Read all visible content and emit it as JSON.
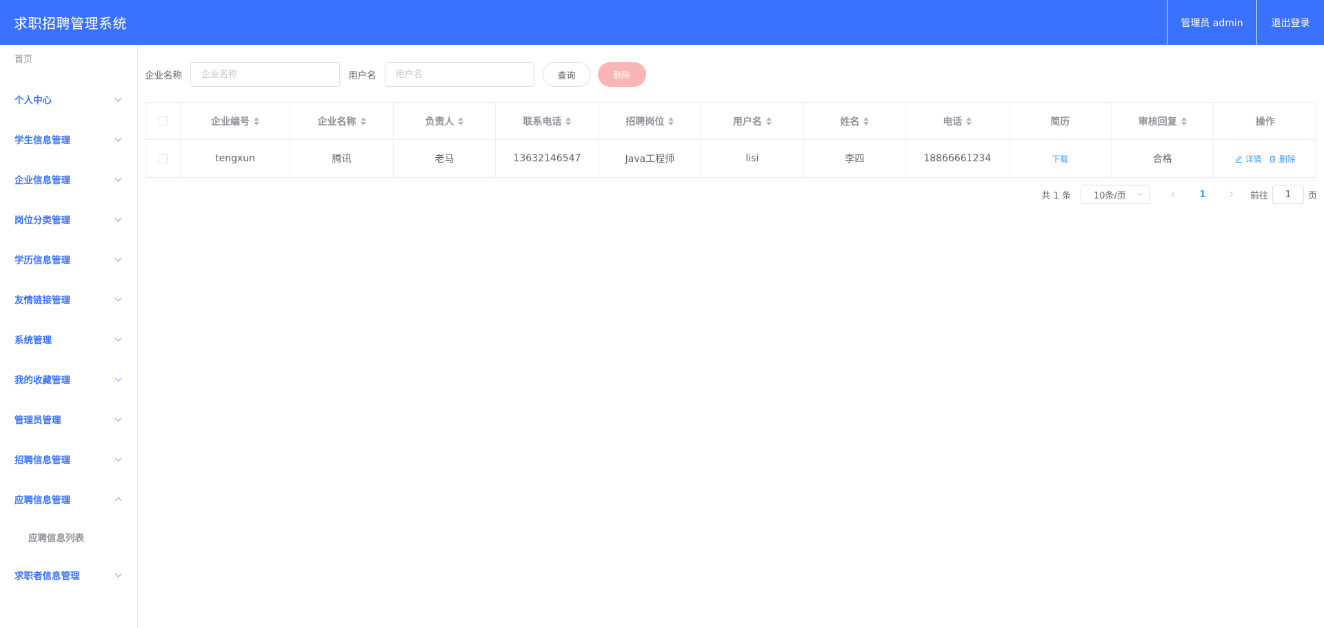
{
  "header": {
    "title": "求职招聘管理系统",
    "admin_label": "管理员 admin",
    "logout_label": "退出登录",
    "color": "#3a72ff"
  },
  "sidebar": {
    "home_label": "首页",
    "items": [
      {
        "label": "个人中心",
        "open": false
      },
      {
        "label": "学生信息管理",
        "open": false
      },
      {
        "label": "企业信息管理",
        "open": false
      },
      {
        "label": "岗位分类管理",
        "open": false
      },
      {
        "label": "学历信息管理",
        "open": false
      },
      {
        "label": "友情链接管理",
        "open": false
      },
      {
        "label": "系统管理",
        "open": false
      },
      {
        "label": "我的收藏管理",
        "open": false
      },
      {
        "label": "管理员管理",
        "open": false
      },
      {
        "label": "招聘信息管理",
        "open": false
      },
      {
        "label": "应聘信息管理",
        "open": true
      },
      {
        "label": "求职者信息管理",
        "open": false
      }
    ],
    "sub_item_label": "应聘信息列表"
  },
  "search": {
    "company_label": "企业名称",
    "company_placeholder": "企业名称",
    "user_label": "用户名",
    "user_placeholder": "用户名",
    "query_label": "查询",
    "delete_label": "删除"
  },
  "table": {
    "headers": [
      "企业编号",
      "企业名称",
      "负责人",
      "联系电话",
      "招聘岗位",
      "用户名",
      "姓名",
      "电话",
      "简历",
      "审核回复",
      "操作"
    ],
    "rows": [
      {
        "company_id": "tengxun",
        "company_name": "腾讯",
        "manager": "老马",
        "contact_phone": "13632146547",
        "position": "Java工程师",
        "username": "lisi",
        "name": "李四",
        "phone": "18866661234",
        "resume": "下载",
        "review": "合格",
        "detail_label": "详情",
        "delete_label": "删除"
      }
    ]
  },
  "pagination": {
    "total": "共 1 条",
    "page_size": "10条/页",
    "current_page": "1",
    "goto_label": "前往",
    "goto_value": "1",
    "page_suffix": "页"
  }
}
